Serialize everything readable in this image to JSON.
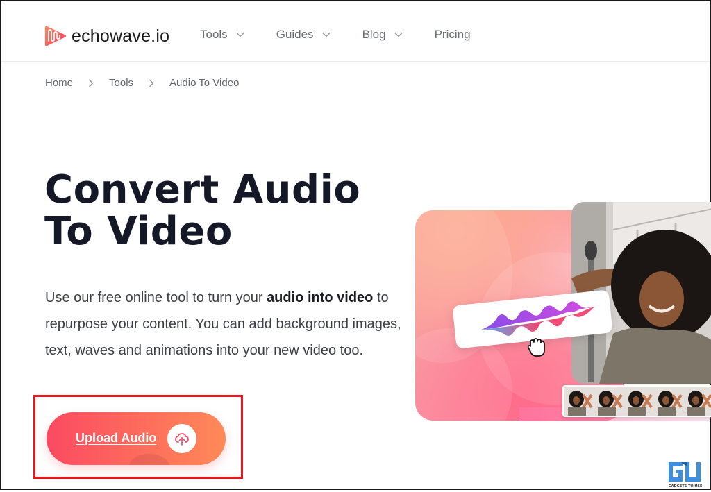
{
  "header": {
    "logo_text": "echowave.io",
    "nav": [
      {
        "label": "Tools",
        "has_dropdown": true
      },
      {
        "label": "Guides",
        "has_dropdown": true
      },
      {
        "label": "Blog",
        "has_dropdown": true
      },
      {
        "label": "Pricing",
        "has_dropdown": false
      }
    ]
  },
  "breadcrumb": [
    {
      "label": "Home"
    },
    {
      "label": "Tools"
    },
    {
      "label": "Audio To Video"
    }
  ],
  "hero": {
    "title_line1": "Convert Audio",
    "title_line2": "To Video",
    "desc_part1": "Use our free online tool to turn your ",
    "desc_bold": "audio into video",
    "desc_part2": " to repurpose your content. You can add background images, text, waves and animations into your new video too.",
    "upload_button": "Upload Audio",
    "upload_icon": "cloud-upload-icon"
  },
  "illustration": {
    "wave_card_icon": "audio-waveform-icon",
    "cursor_icon": "grab-hand-icon",
    "photo_alt": "smiling woman with curly hair",
    "filmstrip_frames": 5
  },
  "colors": {
    "brand_gradient_start": "#fb4a62",
    "brand_gradient_end": "#fe8a58",
    "title": "#141827",
    "nav_text": "#6b6e77",
    "highlight_box": "#e8161d"
  },
  "watermark": {
    "mark": "GU",
    "text": "GADGETS TO USE"
  }
}
